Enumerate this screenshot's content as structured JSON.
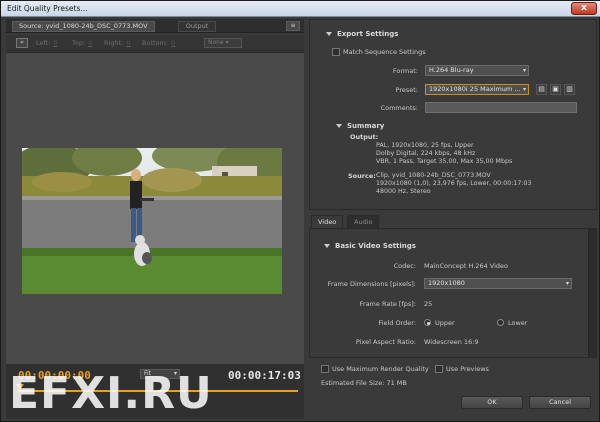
{
  "window": {
    "title": "Edit Quality Presets...",
    "close_glyph": "x"
  },
  "source": {
    "tab_label": "Source: yvid_1080-24b_DSC_0773.MOV",
    "output_tab_label": "Output",
    "panel_menu_glyph": "≡"
  },
  "crop": {
    "left_label": "Left:",
    "left_value": "0",
    "top_label": "Top:",
    "top_value": "0",
    "right_label": "Right:",
    "right_value": "0",
    "bottom_label": "Bottom:",
    "bottom_value": "0",
    "ratio_select": "None"
  },
  "timeline": {
    "current_time": "00:00:00:00",
    "duration": "00:00:17:03",
    "zoom_select": "Fit",
    "progress": 0
  },
  "watermark": "EFXI.RU",
  "export_settings": {
    "heading": "Export Settings",
    "match_sequence_label": "Match Sequence Settings",
    "match_sequence_checked": false,
    "format_label": "Format:",
    "format_value": "H.264 Blu-ray",
    "preset_label": "Preset:",
    "preset_value": "1920x1080i 25 Maximum ...",
    "comments_label": "Comments:",
    "comments_value": ""
  },
  "summary": {
    "heading": "Summary",
    "output_label": "Output:",
    "output_lines": [
      "PAL, 1920x1080, 25 fps, Upper",
      "Dolby Digital, 224 kbps, 48 kHz",
      "VBR, 1 Pass, Target 35,00, Max 35,00 Mbps"
    ],
    "source_label": "Source:",
    "source_lines": [
      "Clip, yvid_1080-24b_DSC_0773.MOV",
      "1920x1080 (1,0), 23,976 fps, Lower, 00:00:17:03",
      "48000 Hz, Stereo"
    ]
  },
  "tabs": [
    {
      "label": "Video",
      "active": true
    },
    {
      "label": "Audio",
      "active": false
    }
  ],
  "video_settings": {
    "heading": "Basic Video Settings",
    "codec_label": "Codec:",
    "codec_value": "MainConcept H.264 Video",
    "frame_dim_label": "Frame Dimensions [pixels]:",
    "frame_dim_value": "1920x1080",
    "frame_rate_label": "Frame Rate [fps]:",
    "frame_rate_value": "25",
    "field_order_label": "Field Order:",
    "field_order_upper": "Upper",
    "field_order_lower": "Lower",
    "field_order_selected": "Upper",
    "par_label": "Pixel Aspect Ratio:",
    "par_value": "Widescreen 16:9"
  },
  "bottom": {
    "max_render_label": "Use Maximum Render Quality",
    "use_previews_label": "Use Previews",
    "file_size": "Estimated File Size:  71 MB",
    "ok_label": "OK",
    "cancel_label": "Cancel"
  },
  "colors": {
    "accent": "#e8a020",
    "panel": "#3a3a3a",
    "titlebar": "#d5dfee"
  }
}
